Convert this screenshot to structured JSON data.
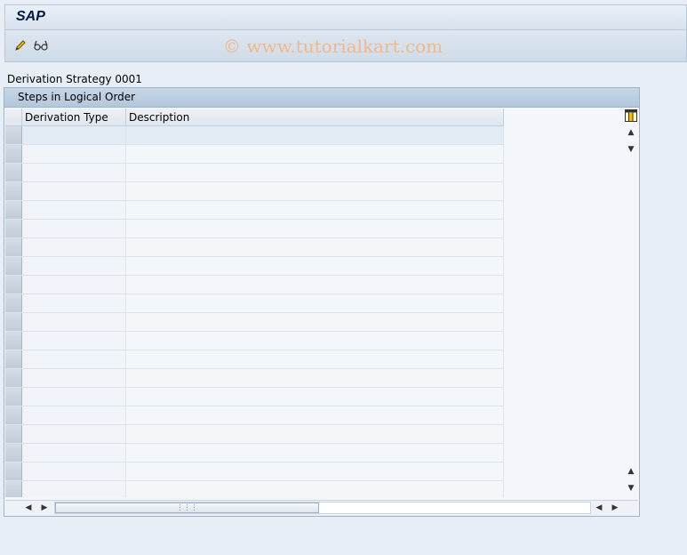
{
  "app": {
    "title": "SAP"
  },
  "watermark": "© www.tutorialkart.com",
  "toolbar": {
    "edit_icon": "pencil-icon",
    "display_icon": "glasses-icon"
  },
  "strategy_label": "Derivation Strategy 0001",
  "group": {
    "title": "Steps in Logical Order",
    "columns": [
      "Derivation Type",
      "Description"
    ],
    "row_count": 20
  },
  "colors": {
    "background": "#e8eef5",
    "header": "#c6d6e6",
    "watermark": "#f0b98a"
  }
}
